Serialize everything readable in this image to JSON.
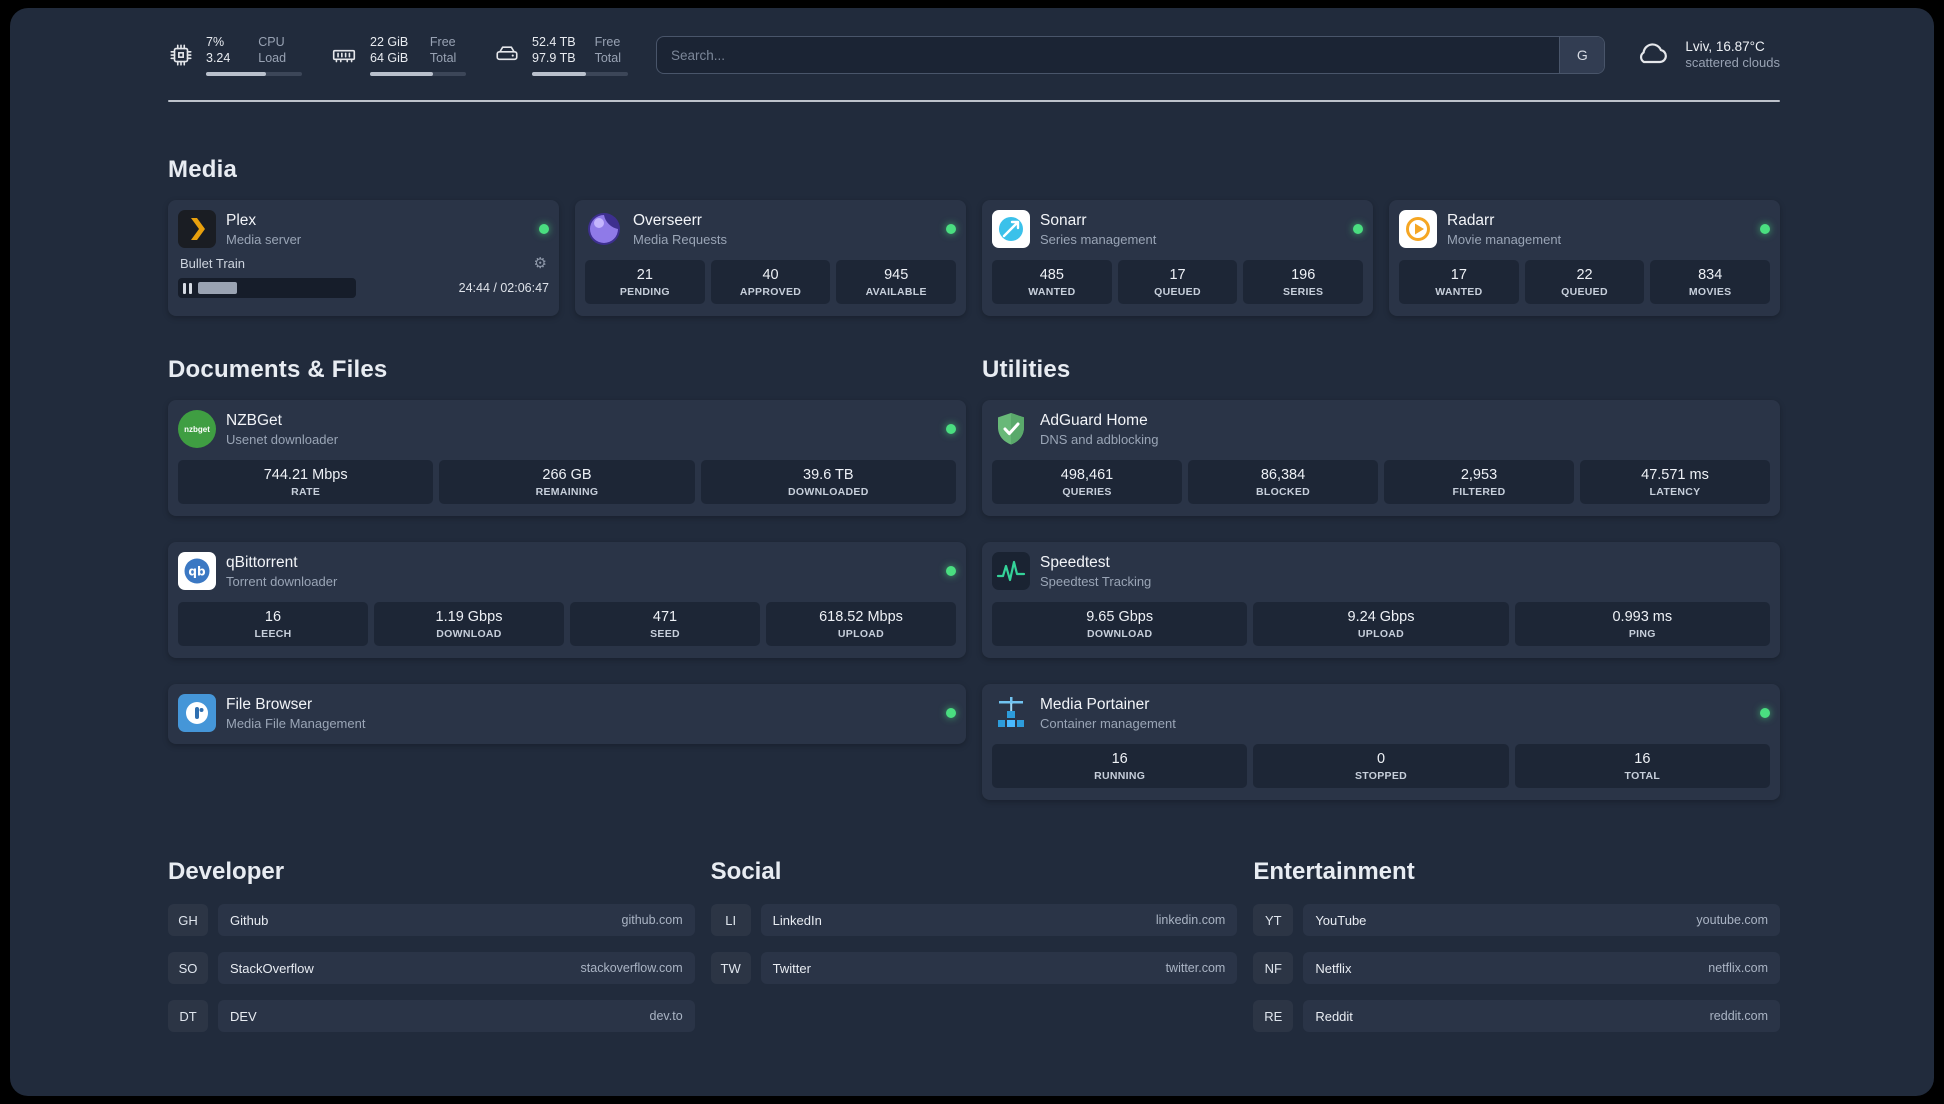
{
  "topbar": {
    "cpu": {
      "usage": "7%",
      "load_value": "3.24",
      "label1": "CPU",
      "label2": "Load"
    },
    "memory": {
      "free": "22 GiB",
      "total": "64 GiB",
      "label1": "Free",
      "label2": "Total"
    },
    "disk": {
      "free": "52.4 TB",
      "total": "97.9 TB",
      "label1": "Free",
      "label2": "Total"
    },
    "search": {
      "placeholder": "Search...",
      "engine_button": "G"
    },
    "weather": {
      "location": "Lviv, 16.87°C",
      "condition": "scattered clouds"
    }
  },
  "sections": {
    "media": "Media",
    "documents": "Documents & Files",
    "utilities": "Utilities"
  },
  "plex": {
    "name": "Plex",
    "desc": "Media server",
    "now_playing": "Bullet Train",
    "time": "24:44 / 02:06:47"
  },
  "media_cards": [
    {
      "name": "Overseerr",
      "desc": "Media Requests",
      "stats": [
        {
          "value": "21",
          "label": "PENDING"
        },
        {
          "value": "40",
          "label": "APPROVED"
        },
        {
          "value": "945",
          "label": "AVAILABLE"
        }
      ]
    },
    {
      "name": "Sonarr",
      "desc": "Series management",
      "stats": [
        {
          "value": "485",
          "label": "WANTED"
        },
        {
          "value": "17",
          "label": "QUEUED"
        },
        {
          "value": "196",
          "label": "SERIES"
        }
      ]
    },
    {
      "name": "Radarr",
      "desc": "Movie management",
      "stats": [
        {
          "value": "17",
          "label": "WANTED"
        },
        {
          "value": "22",
          "label": "QUEUED"
        },
        {
          "value": "834",
          "label": "MOVIES"
        }
      ]
    }
  ],
  "document_cards": [
    {
      "name": "NZBGet",
      "desc": "Usenet downloader",
      "stats": [
        {
          "value": "744.21 Mbps",
          "label": "RATE"
        },
        {
          "value": "266 GB",
          "label": "REMAINING"
        },
        {
          "value": "39.6 TB",
          "label": "DOWNLOADED"
        }
      ]
    },
    {
      "name": "qBittorrent",
      "desc": "Torrent downloader",
      "stats": [
        {
          "value": "16",
          "label": "LEECH"
        },
        {
          "value": "1.19 Gbps",
          "label": "DOWNLOAD"
        },
        {
          "value": "471",
          "label": "SEED"
        },
        {
          "value": "618.52 Mbps",
          "label": "UPLOAD"
        }
      ]
    },
    {
      "name": "File Browser",
      "desc": "Media File Management",
      "stats": []
    }
  ],
  "utility_cards": [
    {
      "name": "AdGuard Home",
      "desc": "DNS and adblocking",
      "stats": [
        {
          "value": "498,461",
          "label": "QUERIES"
        },
        {
          "value": "86,384",
          "label": "BLOCKED"
        },
        {
          "value": "2,953",
          "label": "FILTERED"
        },
        {
          "value": "47.571 ms",
          "label": "LATENCY"
        }
      ]
    },
    {
      "name": "Speedtest",
      "desc": "Speedtest Tracking",
      "stats": [
        {
          "value": "9.65 Gbps",
          "label": "DOWNLOAD"
        },
        {
          "value": "9.24 Gbps",
          "label": "UPLOAD"
        },
        {
          "value": "0.993 ms",
          "label": "PING"
        }
      ]
    },
    {
      "name": "Media Portainer",
      "desc": "Container management",
      "stats": [
        {
          "value": "16",
          "label": "RUNNING"
        },
        {
          "value": "0",
          "label": "STOPPED"
        },
        {
          "value": "16",
          "label": "TOTAL"
        }
      ]
    }
  ],
  "bookmarks": [
    {
      "title": "Developer",
      "items": [
        {
          "abbr": "GH",
          "name": "Github",
          "domain": "github.com"
        },
        {
          "abbr": "SO",
          "name": "StackOverflow",
          "domain": "stackoverflow.com"
        },
        {
          "abbr": "DT",
          "name": "DEV",
          "domain": "dev.to"
        }
      ]
    },
    {
      "title": "Social",
      "items": [
        {
          "abbr": "LI",
          "name": "LinkedIn",
          "domain": "linkedin.com"
        },
        {
          "abbr": "TW",
          "name": "Twitter",
          "domain": "twitter.com"
        }
      ]
    },
    {
      "title": "Entertainment",
      "items": [
        {
          "abbr": "YT",
          "name": "YouTube",
          "domain": "youtube.com"
        },
        {
          "abbr": "NF",
          "name": "Netflix",
          "domain": "netflix.com"
        },
        {
          "abbr": "RE",
          "name": "Reddit",
          "domain": "reddit.com"
        }
      ]
    }
  ],
  "colors": {
    "status_online": "#4ade80",
    "background": "#212b3c",
    "card": "#2a3447",
    "accent_green": "#34d399"
  }
}
